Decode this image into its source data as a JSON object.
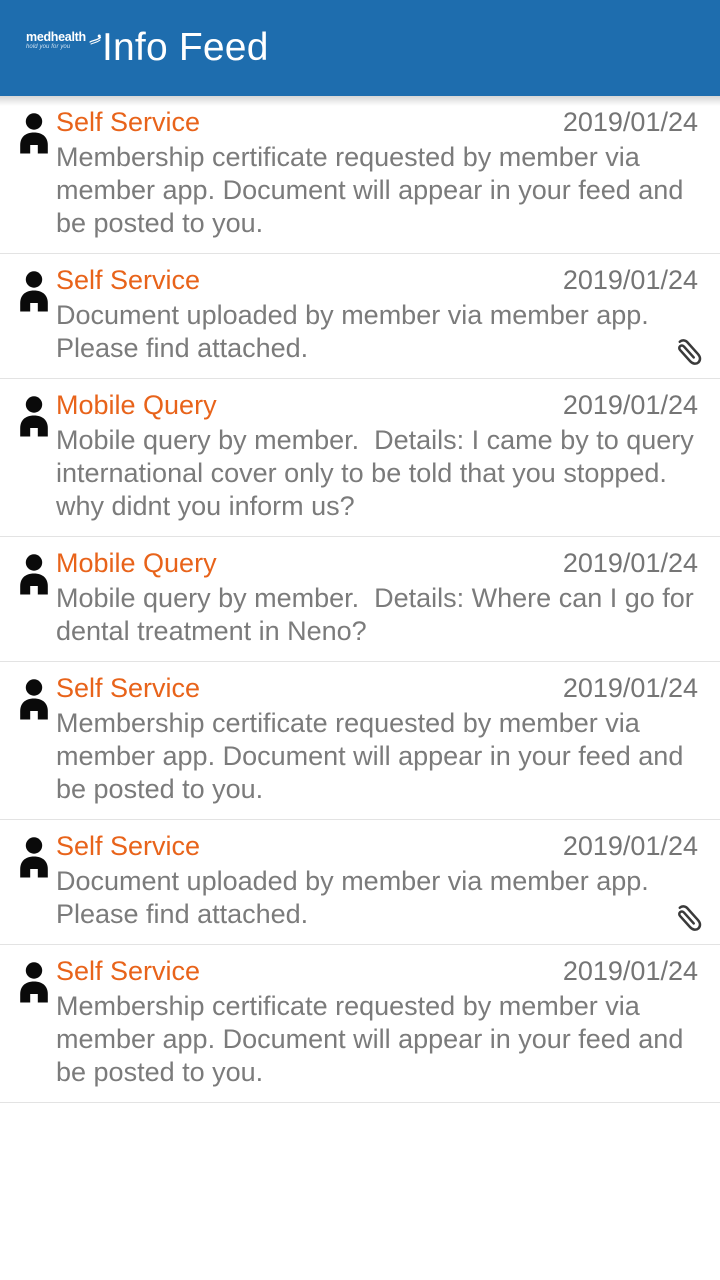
{
  "appbar": {
    "title": "Info Feed",
    "logo_word": "medhealth",
    "logo_tagline": "hold you for you",
    "logo_mark_icon": "medhealth-swoosh-icon",
    "background_color": "#1e6dae",
    "title_color": "#ffffff"
  },
  "colors": {
    "accent_orange": "#e8631a",
    "date_gray": "#757575",
    "body_gray": "#7b7b7b",
    "divider": "#e3e3e3",
    "page_background": "#ffffff"
  },
  "feed": {
    "avatar_icon": "person-icon",
    "attachment_icon": "paperclip-icon",
    "items": [
      {
        "title": "Self Service",
        "date": "2019/01/24",
        "text": "Membership certificate requested by member via member app. Document will appear in your feed and be posted to you.",
        "has_attachment": false
      },
      {
        "title": "Self Service",
        "date": "2019/01/24",
        "text": "Document uploaded by member via member app. Please find attached.",
        "has_attachment": true
      },
      {
        "title": "Mobile Query",
        "date": "2019/01/24",
        "text": "Mobile query by member.  Details: I came by to query international cover only to be told that you stopped. why didnt you inform us?",
        "has_attachment": false
      },
      {
        "title": "Mobile Query",
        "date": "2019/01/24",
        "text": "Mobile query by member.  Details: Where can I go for dental treatment in Neno?",
        "has_attachment": false
      },
      {
        "title": "Self Service",
        "date": "2019/01/24",
        "text": "Membership certificate requested by member via member app. Document will appear in your feed and be posted to you.",
        "has_attachment": false
      },
      {
        "title": "Self Service",
        "date": "2019/01/24",
        "text": "Document uploaded by member via member app. Please find attached.",
        "has_attachment": true
      },
      {
        "title": "Self Service",
        "date": "2019/01/24",
        "text": "Membership certificate requested by member via member app. Document will appear in your feed and be posted to you.",
        "has_attachment": false
      }
    ]
  }
}
